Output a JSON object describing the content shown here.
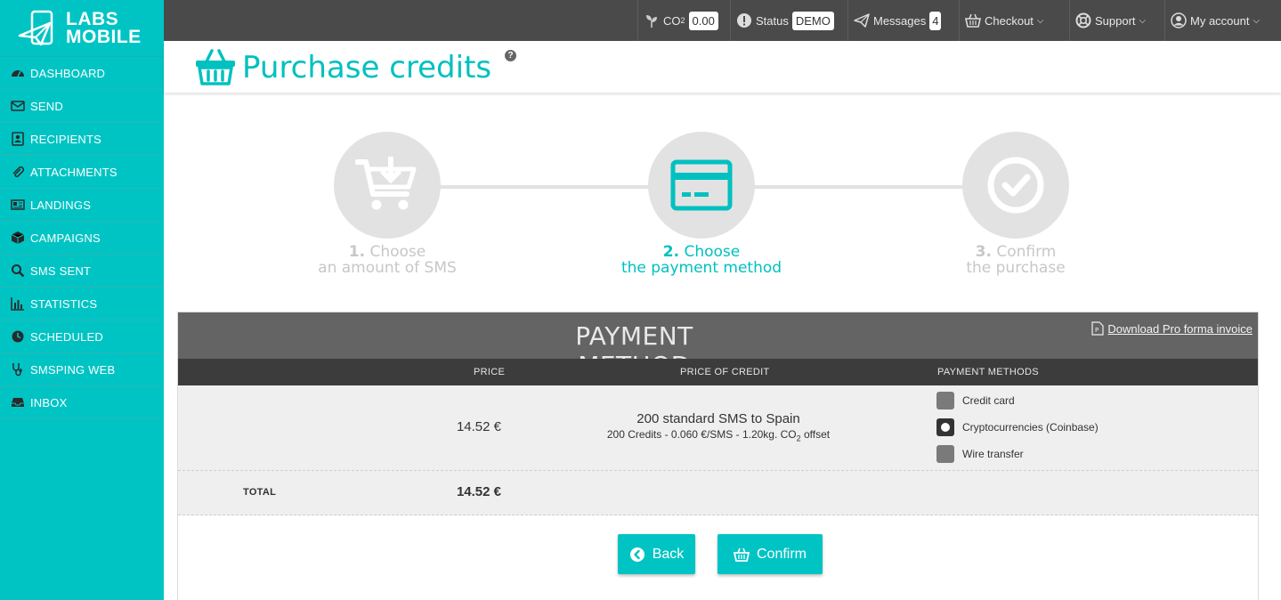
{
  "logo": {
    "line1": "LABS",
    "line2": "MOBILE"
  },
  "sidebar": {
    "items": [
      {
        "label": "DASHBOARD",
        "icon": "dashboard-icon"
      },
      {
        "label": "SEND",
        "icon": "envelope-icon"
      },
      {
        "label": "RECIPIENTS",
        "icon": "contact-card-icon"
      },
      {
        "label": "ATTACHMENTS",
        "icon": "paperclip-icon"
      },
      {
        "label": "LANDINGS",
        "icon": "newspaper-icon"
      },
      {
        "label": "CAMPAIGNS",
        "icon": "cube-icon"
      },
      {
        "label": "SMS SENT",
        "icon": "search-icon"
      },
      {
        "label": "STATISTICS",
        "icon": "bar-chart-icon"
      },
      {
        "label": "SCHEDULED",
        "icon": "clock-icon"
      },
      {
        "label": "SMSPING WEB",
        "icon": "stethoscope-icon"
      },
      {
        "label": "INBOX",
        "icon": "inbox-icon"
      }
    ]
  },
  "topbar": {
    "co2_label": "CO",
    "co2_sub": "2",
    "co2_value": "0.00",
    "status_label": "Status",
    "status_value": "DEMO",
    "messages_label": "Messages",
    "messages_count": "4",
    "checkout_label": "Checkout",
    "support_label": "Support",
    "account_label": "My account"
  },
  "page": {
    "title": "Purchase credits",
    "help": "?"
  },
  "steps": [
    {
      "num": "1.",
      "line1": "Choose",
      "line2": "an amount of SMS",
      "active": false
    },
    {
      "num": "2.",
      "line1": "Choose",
      "line2": "the payment method",
      "active": true
    },
    {
      "num": "3.",
      "line1": "Confirm",
      "line2": "the purchase",
      "active": false
    }
  ],
  "payment": {
    "title": "PAYMENT METHOD",
    "proforma_link": "Download Pro forma invoice",
    "headers": {
      "price": "PRICE",
      "price_of_credit": "PRICE OF CREDIT",
      "payment_methods": "PAYMENT METHODS"
    },
    "row": {
      "price": "14.52 €",
      "desc_main": "200 standard SMS to Spain",
      "desc_sub_before": "200 Credits - 0.060 €/SMS - 1.20kg. CO",
      "desc_sub_sub": "2",
      "desc_sub_after": " offset"
    },
    "methods": [
      {
        "label": "Credit card",
        "selected": false
      },
      {
        "label": "Cryptocurrencies (Coinbase)",
        "selected": true
      },
      {
        "label": "Wire transfer",
        "selected": false
      }
    ],
    "total_label": "TOTAL",
    "total_value": "14.52 €"
  },
  "buttons": {
    "back": "Back",
    "confirm": "Confirm"
  },
  "colors": {
    "accent": "#00c4c4",
    "topbar": "#4a4a4a",
    "table_head": "#646464",
    "col_head": "#3c3c3c"
  }
}
